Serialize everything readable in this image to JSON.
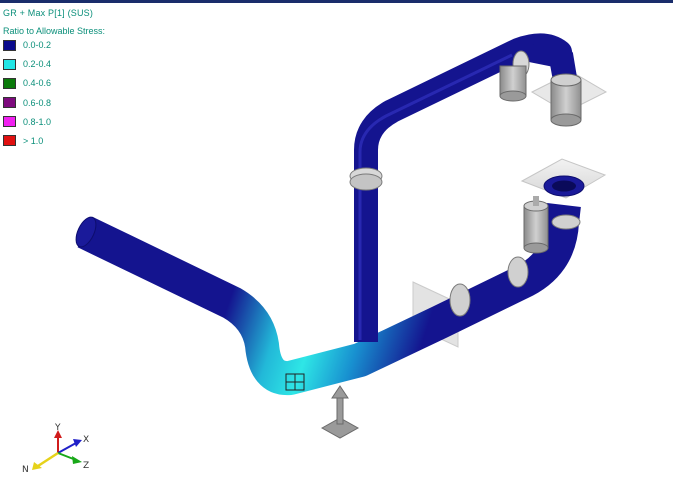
{
  "view": {
    "title": "GR + Max P[1]  (SUS)",
    "legend_heading": "Ratio to Allowable Stress:"
  },
  "legend": [
    {
      "label": "0.0-0.2",
      "color": "#0a0a8c"
    },
    {
      "label": "0.2-0.4",
      "color": "#22e6e6"
    },
    {
      "label": "0.4-0.6",
      "color": "#0a7a0a"
    },
    {
      "label": "0.6-0.8",
      "color": "#7d0a7d"
    },
    {
      "label": "0.8-1.0",
      "color": "#f020f0"
    },
    {
      "label": "> 1.0",
      "color": "#e01010"
    }
  ],
  "triad": {
    "x": "X",
    "y": "Y",
    "z": "Z",
    "n": "N"
  },
  "colors": {
    "pipe_dark": "#14148f",
    "pipe_cyan": "#2ee6e6",
    "support": "#b8b8b8"
  },
  "icons": [
    "restraint-icon",
    "anchor-icon",
    "hanger-icon",
    "spring-can-icon",
    "axis-triad-icon"
  ]
}
